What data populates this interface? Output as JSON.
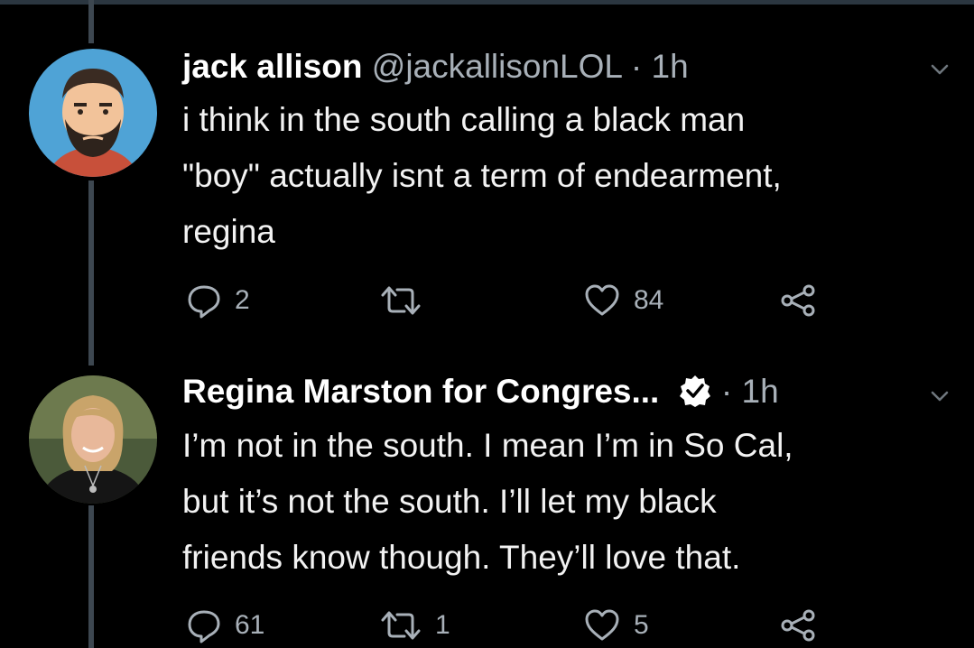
{
  "tweets": [
    {
      "name": "jack allison",
      "handle": "@jackallisonLOL",
      "separator": "·",
      "time": "1h",
      "verified": false,
      "text_lines": [
        "i think in the south calling a black man",
        "\"boy\" actually isnt a term of endearment,",
        "regina"
      ],
      "replies": "2",
      "retweets": "",
      "likes": "84",
      "avatar_icon": "cartoon-bearded-man-avatar"
    },
    {
      "name": "Regina Marston for Congres...",
      "handle": "",
      "separator": "·",
      "time": "1h",
      "verified": true,
      "text_lines": [
        "I’m not in the south. I mean I’m in So Cal,",
        "but it’s not the south. I’ll let my black",
        "friends know though. They’ll love that."
      ],
      "replies": "61",
      "retweets": "1",
      "likes": "5",
      "avatar_icon": "woman-photo-avatar"
    }
  ],
  "colors": {
    "background": "#000000",
    "primary_text": "#f2f2f2",
    "secondary_text": "#a8b0b8",
    "thread_line": "#3d4750",
    "avatar1_bg": "#4fa3d6"
  }
}
